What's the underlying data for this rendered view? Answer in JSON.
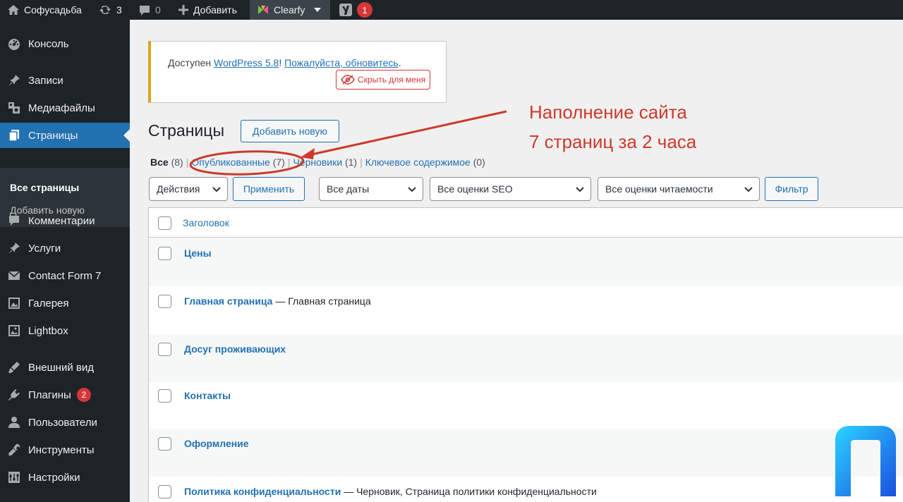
{
  "admin_bar": {
    "site_name": "Софусадьба",
    "updates_count": "3",
    "comments_count": "0",
    "add_label": "Добавить",
    "plugin_name": "Clearfy",
    "seo_badge": "1",
    "icons": [
      "home-icon",
      "updates-icon",
      "comments-icon",
      "plus-icon",
      "clearfy-icon",
      "yoast-icon"
    ]
  },
  "sidebar": {
    "items": [
      {
        "label": "Консоль",
        "icon": "dashboard-icon"
      },
      {
        "label": "Записи",
        "icon": "pin-icon"
      },
      {
        "label": "Медиафайлы",
        "icon": "media-icon"
      },
      {
        "label": "Страницы",
        "icon": "pages-icon"
      },
      {
        "label": "Комментарии",
        "icon": "comment-icon"
      },
      {
        "label": "Услуги",
        "icon": "pin-icon"
      },
      {
        "label": "Contact Form 7",
        "icon": "mail-icon"
      },
      {
        "label": "Галерея",
        "icon": "gallery-icon"
      },
      {
        "label": "Lightbox",
        "icon": "image-icon"
      },
      {
        "label": "Внешний вид",
        "icon": "brush-icon"
      },
      {
        "label": "Плагины",
        "icon": "plugin-icon",
        "badge": "2"
      },
      {
        "label": "Пользователи",
        "icon": "user-icon"
      },
      {
        "label": "Инструменты",
        "icon": "wrench-icon"
      },
      {
        "label": "Настройки",
        "icon": "settings-icon"
      }
    ],
    "submenu": [
      "Все страницы",
      "Добавить новую"
    ]
  },
  "notice": {
    "prefix": "Доступен ",
    "version_link": "WordPress 5.8",
    "middle": "! ",
    "update_link": "Пожалуйста, обновитесь",
    "suffix": ".",
    "hide_button": "Скрыть для меня"
  },
  "page": {
    "title": "Страницы",
    "add_new": "Добавить новую"
  },
  "filters": {
    "all": "Все",
    "all_count": "(8)",
    "published": "Опубликованные",
    "published_count": "(7)",
    "drafts": "Черновики",
    "drafts_count": "(1)",
    "cornerstone": "Ключевое содержимое",
    "cornerstone_count": "(0)",
    "sep": "|"
  },
  "toolbar": {
    "bulk_actions": "Действия",
    "apply": "Применить",
    "dates": "Все даты",
    "seo": "Все оценки SEO",
    "readability": "Все оценки читаемости",
    "filter": "Фильтр"
  },
  "table": {
    "header": "Заголовок",
    "rows": [
      {
        "title": "Цены",
        "state": ""
      },
      {
        "title": "Главная страница",
        "state": " — Главная страница"
      },
      {
        "title": "Досуг проживающих",
        "state": ""
      },
      {
        "title": "Контакты",
        "state": ""
      },
      {
        "title": "Оформление",
        "state": ""
      },
      {
        "title": "Политика конфиденциальности",
        "state": " — Черновик, Страница политики конфиденциальности"
      }
    ]
  },
  "annotation": {
    "line1": "Наполнение сайта",
    "line2": "7 страниц за 2 часа",
    "color": "#cc3a2a"
  },
  "colors": {
    "admin_bar": "#1d2327",
    "accent": "#2271b1",
    "notice_border": "#dba617",
    "badge": "#d63638"
  }
}
